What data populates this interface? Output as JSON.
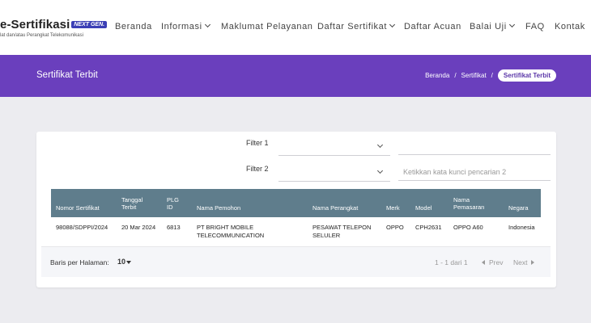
{
  "header": {
    "logo_title": "e-Sertifikasi",
    "logo_badge": "NEXT GEN.",
    "logo_subtitle": "lat dan/atau Perangkat Telekomunikasi",
    "nav": [
      {
        "label": "Beranda",
        "icon": ""
      },
      {
        "label": "Informasi",
        "icon": "chevron-down-icon"
      },
      {
        "label": "Maklumat Pelayanan",
        "icon": ""
      },
      {
        "label": "Daftar Sertifikat",
        "icon": "chevron-down-icon"
      },
      {
        "label": "Daftar Acuan",
        "icon": ""
      },
      {
        "label": "Balai Uji",
        "icon": "chevron-down-icon"
      },
      {
        "label": "FAQ",
        "icon": ""
      },
      {
        "label": "Kontak",
        "icon": ""
      }
    ]
  },
  "band": {
    "title": "Sertifikat Terbit",
    "breadcrumb": [
      "Beranda",
      "Sertifikat",
      "Sertifikat Terbit"
    ],
    "color": "#6a3fbd"
  },
  "filters": {
    "filter1_label": "Filter 1",
    "filter2_label": "Filter 2",
    "filter1_value": "",
    "filter2_value": "",
    "search1_value": "",
    "search1_placeholder": "",
    "search2_value": "",
    "search2_placeholder": "Ketikkan kata kunci pencarian 2"
  },
  "table": {
    "header_color": "#5f7d8c",
    "columns": [
      "Nomor Sertifikat",
      "Tanggal\nTerbit",
      "PLG\nID",
      "Nama Pemohon",
      "Nama Perangkat",
      "Merk",
      "Model",
      "Nama\nPemasaran",
      "Negara"
    ],
    "rows": [
      [
        "98088/SDPPI/2024",
        "20 Mar 2024",
        "6813",
        "PT BRIGHT MOBILE\nTELECOMMUNICATION",
        "PESAWAT TELEPON\nSELULER",
        "OPPO",
        "CPH2631",
        "OPPO A60",
        "Indonesia"
      ]
    ]
  },
  "pagination": {
    "rows_per_page_label": "Baris per Halaman:",
    "rows_per_page_value": "10",
    "range_text": "1 - 1 dari 1",
    "prev_label": "Prev",
    "next_label": "Next"
  }
}
